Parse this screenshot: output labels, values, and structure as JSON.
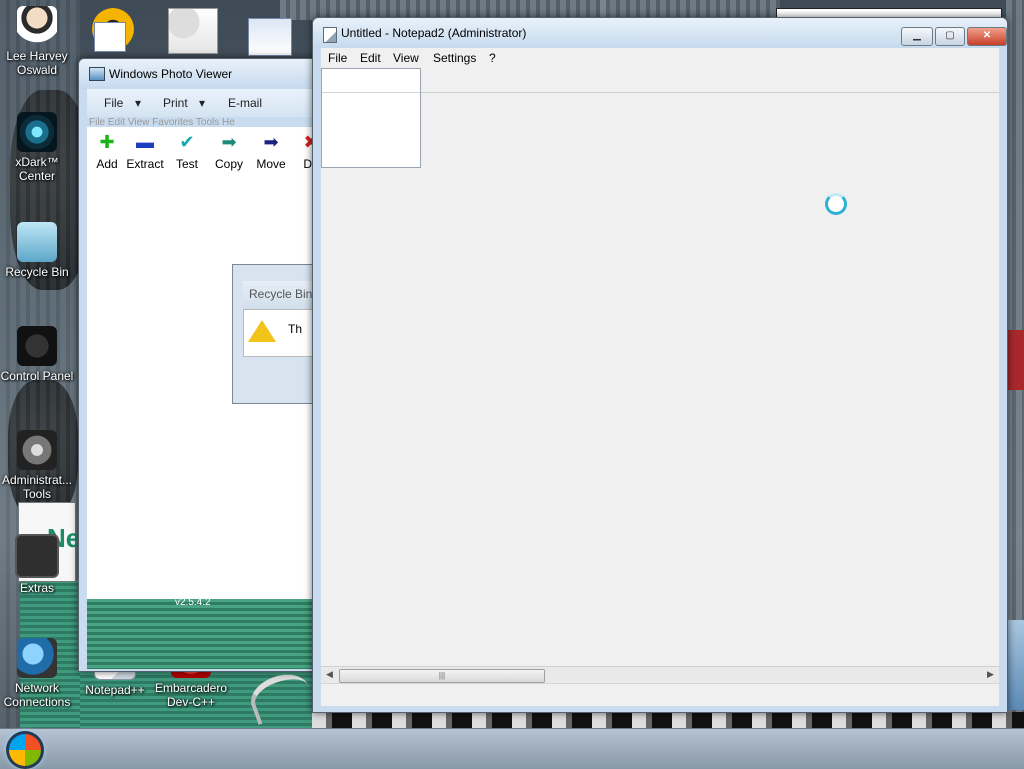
{
  "desktop": {
    "icons": [
      {
        "label": "Lee Harvey Oswald"
      },
      {
        "label": "xDark™ Center"
      },
      {
        "label": "Recycle Bin"
      },
      {
        "label": "Control Panel"
      },
      {
        "label": "Administrat... Tools"
      },
      {
        "label": "Extras"
      },
      {
        "label": "Network Connections"
      },
      {
        "label": "Notepad++"
      },
      {
        "label": "Embarcadero Dev-C++"
      }
    ],
    "wallpaper_version": "v2.5.4.2"
  },
  "photo_viewer": {
    "title": "Windows Photo Viewer",
    "menu": {
      "file": "File",
      "print": "Print",
      "email": "E-mail"
    },
    "ghost_menu": "File   Edit   View   Favorites   Tools   He",
    "toolbar": [
      {
        "label": "Add",
        "icon": "plus-icon",
        "glyph": "✚",
        "color": "#18b418"
      },
      {
        "label": "Extract",
        "icon": "minus-icon",
        "glyph": "▬",
        "color": "#1b3fbf"
      },
      {
        "label": "Test",
        "icon": "check-icon",
        "glyph": "✔",
        "color": "#19a9b6"
      },
      {
        "label": "Copy",
        "icon": "arrow-right-icon",
        "glyph": "➡",
        "color": "#1d8b7a"
      },
      {
        "label": "Move",
        "icon": "arrow-right-icon",
        "glyph": "➡",
        "color": "#1a237e"
      },
      {
        "label": "De",
        "icon": "delete-icon",
        "glyph": "✖",
        "color": "#d32020"
      }
    ]
  },
  "recycle_dialog": {
    "title": "Recycle Bin",
    "message": "Th"
  },
  "notepad": {
    "title": "Untitled - Notepad2 (Administrator)",
    "menu": [
      "File",
      "Edit",
      "View",
      "Settings",
      "?"
    ],
    "controls": {
      "minimize": "▁",
      "maximize": "▢",
      "close": "✕"
    },
    "scroll_thumb": "|||",
    "scroll_left": "◀",
    "scroll_right": "▶"
  },
  "colors": {
    "accent": "#2fb3d4",
    "close": "#c6402a"
  }
}
